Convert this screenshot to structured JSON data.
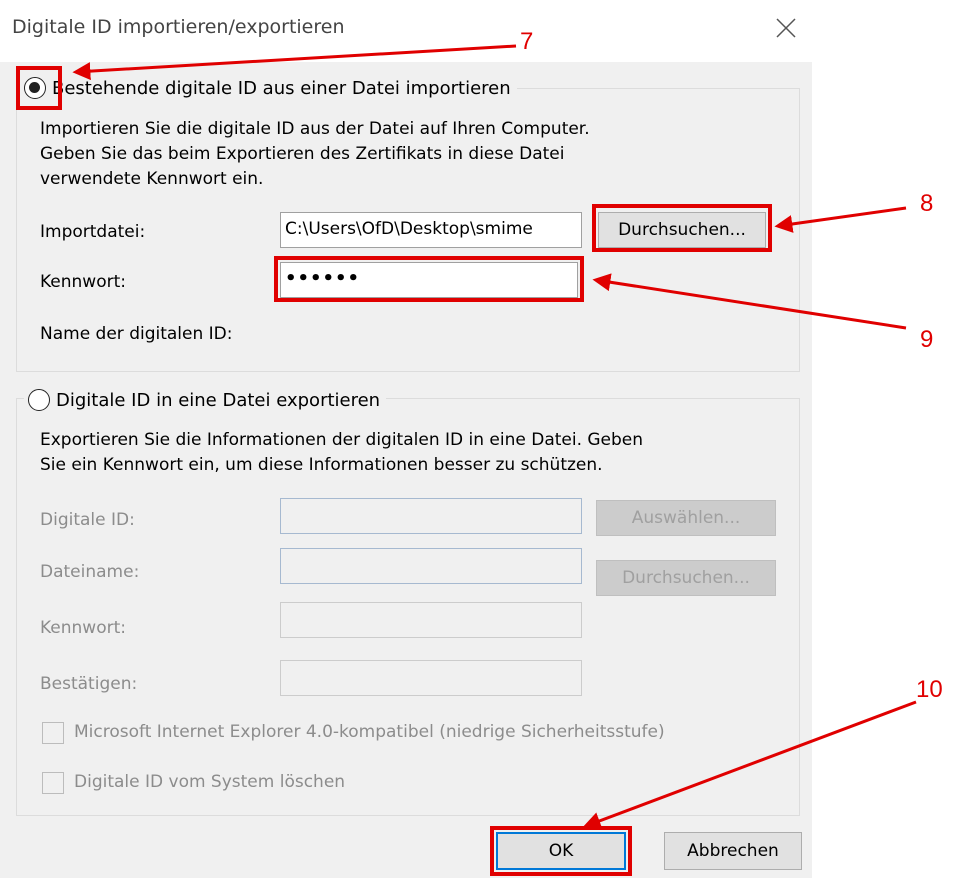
{
  "dialog": {
    "title": "Digitale ID importieren/exportieren",
    "close_icon": "close-icon"
  },
  "import_section": {
    "radio_label": "Bestehende digitale ID aus einer Datei importieren",
    "selected": true,
    "description": [
      "Importieren Sie die digitale ID aus der Datei auf Ihren Computer.",
      "Geben Sie das beim Exportieren des Zertifikats in diese Datei",
      "verwendete Kennwort ein."
    ],
    "import_file_label": "Importdatei:",
    "import_file_value": "C:\\Users\\OfD\\Desktop\\smime",
    "browse_label": "Durchsuchen...",
    "password_label": "Kennwort:",
    "password_value": "••••••",
    "digital_id_name_label": "Name der digitalen ID:"
  },
  "export_section": {
    "radio_label": "Digitale ID in eine Datei exportieren",
    "selected": false,
    "description": [
      "Exportieren Sie die Informationen der digitalen ID in eine Datei. Geben",
      "Sie ein Kennwort ein, um diese Informationen besser zu schützen."
    ],
    "digital_id_label": "Digitale ID:",
    "select_label": "Auswählen...",
    "filename_label": "Dateiname:",
    "browse_label": "Durchsuchen...",
    "password_label": "Kennwort:",
    "confirm_label": "Bestätigen:",
    "ie_compat_label": "Microsoft Internet Explorer 4.0-kompatibel (niedrige Sicherheitsstufe)",
    "delete_label": "Digitale ID vom System löschen"
  },
  "footer": {
    "ok_label": "OK",
    "cancel_label": "Abbrechen"
  },
  "annotations": {
    "color": "#e00000",
    "labels": [
      "7",
      "8",
      "9",
      "10"
    ]
  }
}
